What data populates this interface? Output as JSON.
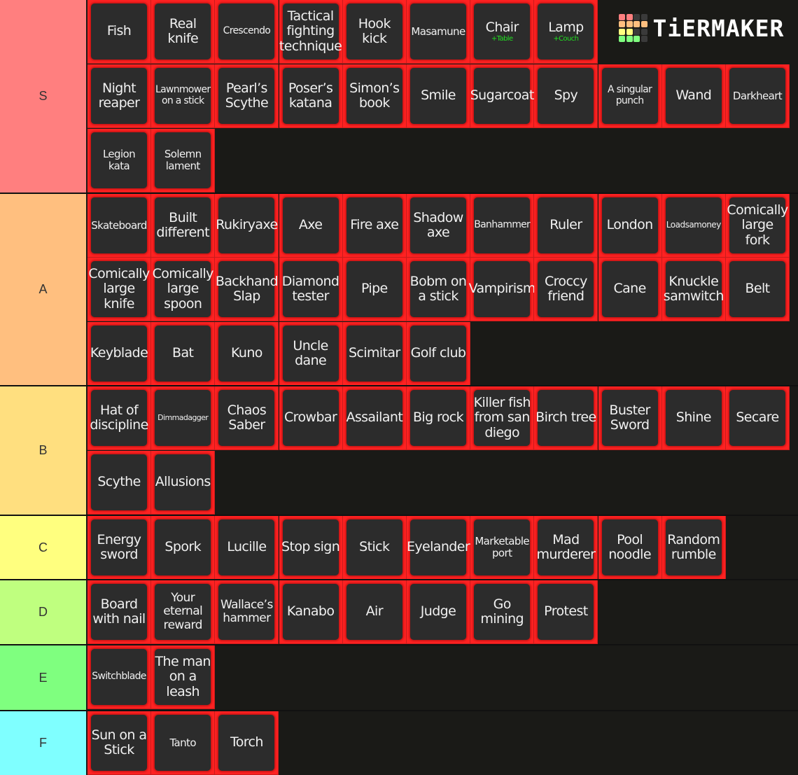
{
  "app": {
    "name": "TierMaker",
    "logo_text": "TiERMAKER",
    "logo_grid_colors": [
      "#ff7f7f",
      "#ff7f7f",
      "#3a3a3a",
      "#3a3a3a",
      "#ffbf7f",
      "#ffbf7f",
      "#ffbf7f",
      "#ffbf7f",
      "#ffff7f",
      "#ffff7f",
      "#3a3a3a",
      "#3a3a3a",
      "#7fff7f",
      "#7fff7f",
      "#7fff7f",
      "#3a3a3a"
    ]
  },
  "colors": {
    "item_border": "#ff2222",
    "item_background": "#2c2c2c",
    "board_background": "#1a1a17",
    "subtext_green": "#22dd22"
  },
  "tiers": [
    {
      "label": "S",
      "color": "#ff7f7f",
      "items": [
        {
          "text": "Fish"
        },
        {
          "text": "Real knife"
        },
        {
          "text": "Crescendo"
        },
        {
          "text": "Tactical fighting technique"
        },
        {
          "text": "Hook kick"
        },
        {
          "text": "Masamune"
        },
        {
          "text": "Chair",
          "sub": "+Table"
        },
        {
          "text": "Lamp",
          "sub": "+Couch"
        },
        {
          "text": "Night reaper"
        },
        {
          "text": "Lawnmower on a stick"
        },
        {
          "text": "Pearl’s Scythe"
        },
        {
          "text": "Poser’s katana"
        },
        {
          "text": "Simon’s book"
        },
        {
          "text": "Smile"
        },
        {
          "text": "Sugarcoat"
        },
        {
          "text": "Spy"
        },
        {
          "text": "A singular punch"
        },
        {
          "text": "Wand"
        },
        {
          "text": "Darkheart"
        },
        {
          "text": "Legion kata"
        },
        {
          "text": "Solemn lament"
        }
      ]
    },
    {
      "label": "A",
      "color": "#ffbf7f",
      "items": [
        {
          "text": "Skateboard"
        },
        {
          "text": "Built different"
        },
        {
          "text": "Rukiryaxe"
        },
        {
          "text": "Axe"
        },
        {
          "text": "Fire axe"
        },
        {
          "text": "Shadow axe"
        },
        {
          "text": "Banhammer"
        },
        {
          "text": "Ruler"
        },
        {
          "text": "London"
        },
        {
          "text": "Loadsamoney"
        },
        {
          "text": "Comically large fork"
        },
        {
          "text": "Comically large knife"
        },
        {
          "text": "Comically large spoon"
        },
        {
          "text": "Backhand Slap"
        },
        {
          "text": "Diamond tester"
        },
        {
          "text": "Pipe"
        },
        {
          "text": "Bobm on a stick"
        },
        {
          "text": "Vampirism"
        },
        {
          "text": "Croccy friend"
        },
        {
          "text": "Cane"
        },
        {
          "text": "Knuckle samwitch"
        },
        {
          "text": "Belt"
        },
        {
          "text": "Keyblade"
        },
        {
          "text": "Bat"
        },
        {
          "text": "Kuno"
        },
        {
          "text": "Uncle dane"
        },
        {
          "text": "Scimitar"
        },
        {
          "text": "Golf club"
        }
      ]
    },
    {
      "label": "B",
      "color": "#ffdf7f",
      "items": [
        {
          "text": "Hat of discipline"
        },
        {
          "text": "Dimmadagger"
        },
        {
          "text": "Chaos Saber"
        },
        {
          "text": "Crowbar"
        },
        {
          "text": "Assailant"
        },
        {
          "text": "Big rock"
        },
        {
          "text": "Killer fish from san diego"
        },
        {
          "text": "Birch tree"
        },
        {
          "text": "Buster Sword"
        },
        {
          "text": "Shine"
        },
        {
          "text": "Secare"
        },
        {
          "text": "Scythe"
        },
        {
          "text": "Allusions"
        }
      ]
    },
    {
      "label": "C",
      "color": "#ffff7f",
      "items": [
        {
          "text": "Energy sword"
        },
        {
          "text": "Spork"
        },
        {
          "text": "Lucille"
        },
        {
          "text": "Stop sign"
        },
        {
          "text": "Stick"
        },
        {
          "text": "Eyelander"
        },
        {
          "text": "Marketable port"
        },
        {
          "text": "Mad murderer"
        },
        {
          "text": "Pool noodle"
        },
        {
          "text": "Random rumble"
        }
      ]
    },
    {
      "label": "D",
      "color": "#bfff7f",
      "items": [
        {
          "text": "Board with nail"
        },
        {
          "text": "Your eternal reward"
        },
        {
          "text": "Wallace’s hammer"
        },
        {
          "text": "Kanabo"
        },
        {
          "text": "Air"
        },
        {
          "text": "Judge"
        },
        {
          "text": "Go mining"
        },
        {
          "text": "Protest"
        }
      ]
    },
    {
      "label": "E",
      "color": "#7fff7f",
      "items": [
        {
          "text": "Switchblade"
        },
        {
          "text": "The man on a leash"
        }
      ]
    },
    {
      "label": "F",
      "color": "#7fffff",
      "items": [
        {
          "text": "Sun on a Stick"
        },
        {
          "text": "Tanto"
        },
        {
          "text": "Torch"
        }
      ]
    }
  ]
}
